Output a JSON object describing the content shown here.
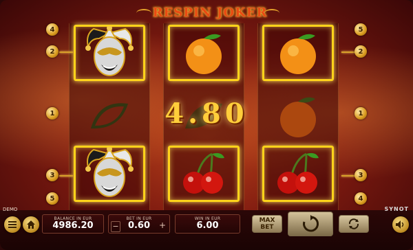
{
  "game": {
    "title": "RESPIN JOKER",
    "brand": "SYNOT",
    "mode_label": "DEMO",
    "win_display": "4.80"
  },
  "paylines": {
    "left": [
      "4",
      "2",
      "1",
      "3",
      "5"
    ],
    "right": [
      "5",
      "2",
      "1",
      "3",
      "4"
    ]
  },
  "reels": [
    {
      "name": "reel-1",
      "symbols": [
        "joker",
        "melon",
        "joker"
      ],
      "highlighted": [
        true,
        false,
        true
      ]
    },
    {
      "name": "reel-2",
      "symbols": [
        "orange",
        "melon",
        "cherry"
      ],
      "highlighted": [
        true,
        false,
        true
      ]
    },
    {
      "name": "reel-3",
      "symbols": [
        "orange",
        "orange",
        "cherry"
      ],
      "highlighted": [
        true,
        false,
        true
      ]
    }
  ],
  "footer": {
    "balance_label": "BALANCE IN EUR",
    "balance_value": "4986.20",
    "bet_label": "BET IN EUR",
    "bet_value": "0.60",
    "bet_minus": "−",
    "bet_plus": "+",
    "win_label": "WIN IN EUR",
    "win_value": "6.00",
    "max_bet_label_1": "MAX",
    "max_bet_label_2": "BET"
  },
  "colors": {
    "highlight": "#ffd31a",
    "badge_gold": "#d99b1e",
    "title_red": "#e94b12",
    "win_gold": "#ffce3b"
  },
  "icons": [
    "menu-icon",
    "home-icon",
    "spin-icon",
    "autoplay-icon",
    "sound-icon"
  ]
}
